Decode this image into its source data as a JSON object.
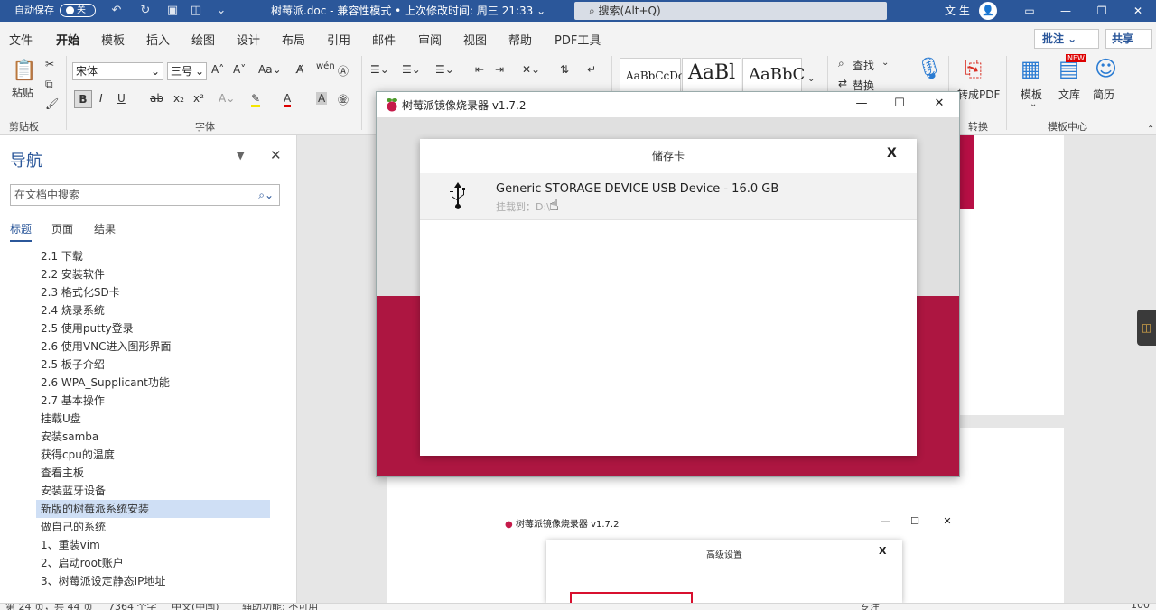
{
  "titlebar": {
    "autosave_label": "自动保存",
    "autosave_toggle": "关",
    "doc_title": "树莓派.doc  -  兼容性模式 • 上次修改时间: 周三 21:33  ⌄",
    "search_placeholder": "搜索(Alt+Q)",
    "user_name": "文 生",
    "avatar_text": "👤",
    "controls": [
      "▭",
      "—",
      "❐",
      "✕"
    ]
  },
  "ribbon_tabs": [
    "文件",
    "开始",
    "模板",
    "插入",
    "绘图",
    "设计",
    "布局",
    "引用",
    "邮件",
    "审阅",
    "视图",
    "帮助",
    "PDF工具"
  ],
  "ribbon_actions": {
    "comment": "批注 ⌄",
    "share": "共享"
  },
  "ribbon": {
    "clipboard": {
      "paste": "粘贴",
      "group": "剪贴板"
    },
    "font": {
      "name": "宋体",
      "size": "三号",
      "group": "字体"
    },
    "styles": [
      "AaBbCcDc",
      "AaBl",
      "AaBbC"
    ],
    "editing": {
      "find": "查找",
      "replace": "替换"
    },
    "convert": {
      "to_pdf": "转成PDF",
      "group": "转换"
    },
    "templates": {
      "template": "模板",
      "library": "文库",
      "resume": "简历",
      "group": "模板中心",
      "new_badge": "NEW"
    }
  },
  "nav_pane": {
    "title": "导航",
    "search_placeholder": "在文档中搜索",
    "tabs": [
      "标题",
      "页面",
      "结果"
    ],
    "items": [
      "2.1 下载",
      "2.2 安装软件",
      "2.3 格式化SD卡",
      "2.4 烧录系统",
      "2.5 使用putty登录",
      "2.6 使用VNC进入图形界面",
      "2.5 板子介绍",
      "2.6 WPA_Supplicant功能",
      "2.7 基本操作",
      "挂载U盘",
      "安装samba",
      "获得cpu的温度",
      "查看主板",
      "安装蓝牙设备",
      "新版的树莓派系统安装",
      "做自己的系统",
      "1、重装vim",
      "2、启动root账户",
      "3、树莓派设定静态IP地址"
    ],
    "selected_index": 14
  },
  "imager": {
    "title": "树莓派镜像烧录器 v1.7.2",
    "controls": [
      "—",
      "☐",
      "✕"
    ],
    "dialog": {
      "title": "储存卡",
      "close": "X",
      "device_name": "Generic STORAGE DEVICE USB Device - 16.0 GB",
      "mount": "挂载到：D:\\"
    },
    "brand_color": "#c51a4a"
  },
  "embedded_screenshot": {
    "title": "树莓派镜像烧录器 v1.7.2",
    "controls": [
      "—",
      "☐",
      "✕"
    ],
    "dialog_title": "高级设置",
    "dialog_close": "X"
  },
  "statusbar": {
    "page": "第 24 页，共 44 页",
    "words": "7364 个字",
    "lang": "中文(中国)",
    "accessibility": "辅助功能: 不可用",
    "focus": "专注",
    "zoom": "100"
  }
}
